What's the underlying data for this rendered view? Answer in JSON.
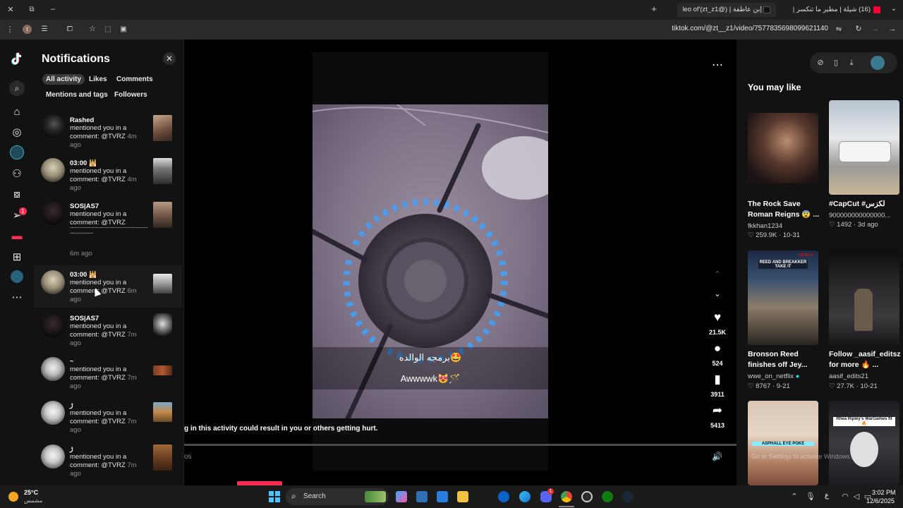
{
  "browser": {
    "tabs": [
      {
        "title": "(16) شيلة | مطير ما تنكسر | كلمات",
        "active": false
      },
      {
        "title": "إبن عاطفة | (@zt_z1)'s video of",
        "active": true
      }
    ],
    "url": "tiktok.com/@zt__z1/video/7577835698099621140",
    "profile_initial": "t"
  },
  "notifications": {
    "title": "Notifications",
    "filters_row1": [
      "All activity",
      "Likes",
      "Comments"
    ],
    "filters_row2": [
      "Mentions and tags",
      "Followers"
    ],
    "items": [
      {
        "name": "Rashed",
        "text": "mentioned you in a comment: @TVRZ",
        "time": "4m ago"
      },
      {
        "name": "03:00 🕌",
        "text": "mentioned you in a comment: @TVRZ",
        "time": "4m ago"
      },
      {
        "name": "SOS|AS7",
        "text": "mentioned you in a comment: @TVRZ",
        "extra": "ٴٴٴٴٴٴٴٴٴٴٴٴٴٴٴٴٴٴٴٴٴٴٴٴٴٴٴٴٴٴٴٴٴٴٴٴٴٴٴٴٴٴٴٴٴٴٴٴٴٴٴٴٴٴٴٴٴٴٴٴٴٴٴٴٴٴٴٴٴٴٴٴٴٴٴٴٴٴٴٴٴٴ",
        "time": "6m ago"
      },
      {
        "name": "03:00 🕌",
        "text": "mentioned you in a comment: @TVRZ",
        "time": "6m ago"
      },
      {
        "name": "SOS|AS7",
        "text": "mentioned you in a comment: @TVRZ",
        "time": "7m ago"
      },
      {
        "name": "~",
        "text": "mentioned you in a comment: @TVRZ",
        "time": "7m ago"
      },
      {
        "name": "ژ",
        "text": "mentioned you in a comment: @TVRZ",
        "time": "7m ago"
      },
      {
        "name": "ژ",
        "text": "mentioned you in a comment: @TVRZ",
        "time": "7m ago"
      }
    ]
  },
  "video": {
    "caption_ar": "برمجه الوالده🤩",
    "caption_en": "Awwwwk😻🪄",
    "warning": "g in this activity could result in you or others getting hurt.",
    "time_label": "os",
    "actions": {
      "likes": "21.5K",
      "comments": "524",
      "saves": "3911",
      "shares": "5413"
    }
  },
  "sidebar": {
    "notif_badge": "1",
    "you_may_like": "You may like",
    "cards": [
      {
        "title": "The Rock Save Roman Reigns 😨 ...",
        "author": "fkkhan1234",
        "likes": "259.9K",
        "date": "10-31"
      },
      {
        "title": "#CapCut #لكزس",
        "author": "900000000000000...",
        "likes": "1492",
        "date": "3d ago"
      },
      {
        "title": "Bronson Reed finishes off Jey...",
        "author": "wwe_on_netflix",
        "likes": "8767",
        "date": "9-21"
      },
      {
        "title": "Follow _aasif_editsz for more 🔥 ...",
        "author": "aasif_edits21",
        "likes": "27.7K",
        "date": "10-21"
      }
    ],
    "thumb_texts": [
      "REED AND BREAKKER TAKE IT",
      "ASPHALL EYE POKE",
      "Rhea Ripley's WarGames fit 🔥",
      "NETFLIX"
    ],
    "watermark": "Go to Settings to activate Windows."
  },
  "taskbar": {
    "weather_temp": "25°C",
    "weather_desc": "مشمس",
    "search_placeholder": "Search",
    "lang": "ع",
    "time": "3:02 PM",
    "date": "12/6/2025",
    "discord_badge": "1"
  },
  "colors": {
    "accent": "#fe2c55",
    "verified": "#20d5ec",
    "panel": "#121212",
    "taskbar": "#1b1b1b"
  }
}
